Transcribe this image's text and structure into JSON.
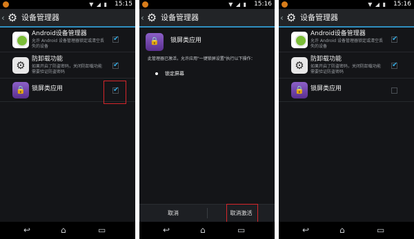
{
  "status_bar": {
    "signal_icons": "▼ ◢ ▮",
    "screens": [
      "15:15",
      "15:16",
      "15:16"
    ]
  },
  "action_bar": {
    "title": "设备管理器"
  },
  "admins": [
    {
      "title": "Android设备管理器",
      "desc": "允许 Android 设备管理器锁定或清空丢失的设备",
      "icon": "android-device-manager-icon"
    },
    {
      "title": "防卸载功能",
      "desc": "如果开启了防盗密码，关闭防卸载功能需要验证防盗密码",
      "icon": "gear-icon"
    },
    {
      "title": "锁屏类应用",
      "desc": "",
      "icon": "lock-app-icon"
    }
  ],
  "screen1_checks": [
    true,
    true,
    true
  ],
  "screen3_checks": [
    true,
    true,
    false
  ],
  "detail": {
    "app_name": "锁屏类应用",
    "message": "此管理器已激活，允许应用\"一键锁屏设置\"执行以下操作：",
    "policy": "锁定屏幕",
    "cancel_label": "取消",
    "deactivate_label": "取消激活"
  },
  "nav_icons": [
    "back-icon",
    "home-icon",
    "recents-icon"
  ],
  "colors": {
    "accent": "#34a6dc",
    "highlight": "#d8262b",
    "background": "#141518"
  }
}
